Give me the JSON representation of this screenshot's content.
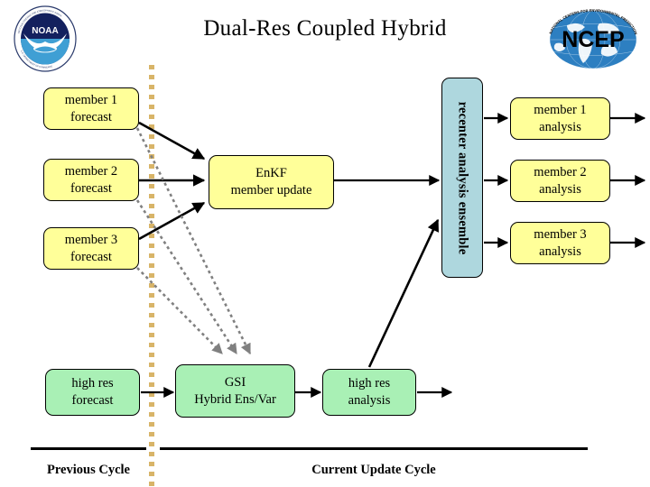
{
  "slide": {
    "title": "Dual-Res Coupled Hybrid",
    "background": "#ffffff"
  },
  "logos": {
    "left": {
      "name": "noaa-logo",
      "text": "NOAA",
      "ring_text": "NATIONAL OCEANIC AND ATMOSPHERIC ADMINISTRATION  •  U.S. DEPARTMENT OF COMMERCE",
      "colors": {
        "dark": "#13205e",
        "light": "#3f9fd4",
        "bird": "#ffffff"
      }
    },
    "right": {
      "name": "ncep-logo",
      "text": "NCEP",
      "ring_text": "NATIONAL CENTERS FOR ENVIRONMENTAL PREDICTION",
      "colors": {
        "globe": "#2d7fc1",
        "land": "#ffffff",
        "label": "#000000"
      }
    }
  },
  "colors": {
    "ensemble_box": "#ffff99",
    "highres_box": "#a9f0b5",
    "recenter_box": "#aed7de",
    "divider_dotted": "#d8b468",
    "solid_arrow": "#000000",
    "dotted_arrow": "#808080",
    "outline": "#000000"
  },
  "boxes": {
    "member1_forecast": {
      "line1": "member 1",
      "line2": "forecast"
    },
    "member2_forecast": {
      "line1": "member 2",
      "line2": "forecast"
    },
    "member3_forecast": {
      "line1": "member 3",
      "line2": "forecast"
    },
    "enkf_update": {
      "line1": "EnKF",
      "line2": "member update"
    },
    "recenter": {
      "label": "recenter analysis ensemble"
    },
    "member1_analysis": {
      "line1": "member 1",
      "line2": "analysis"
    },
    "member2_analysis": {
      "line1": "member 2",
      "line2": "analysis"
    },
    "member3_analysis": {
      "line1": "member 3",
      "line2": "analysis"
    },
    "highres_forecast": {
      "line1": "high res",
      "line2": "forecast"
    },
    "gsi_hybrid": {
      "line1": "GSI",
      "line2": "Hybrid Ens/Var"
    },
    "highres_analysis": {
      "line1": "high res",
      "line2": "analysis"
    }
  },
  "cycles": {
    "previous": "Previous Cycle",
    "current": "Current Update Cycle"
  },
  "flow": {
    "solid_arrows": [
      "member1-forecast-to-enkf",
      "member2-forecast-to-enkf",
      "member3-forecast-to-enkf",
      "enkf-to-recenter",
      "recenter-to-member1-analysis",
      "recenter-to-member2-analysis",
      "recenter-to-member3-analysis",
      "member1-analysis-out",
      "member2-analysis-out",
      "member3-analysis-out",
      "highres-forecast-to-gsi",
      "gsi-to-highres-analysis",
      "highres-analysis-out",
      "highres-analysis-to-recenter"
    ],
    "dotted_arrows": [
      "member1-forecast-to-gsi",
      "member2-forecast-to-gsi",
      "member3-forecast-to-gsi"
    ]
  }
}
